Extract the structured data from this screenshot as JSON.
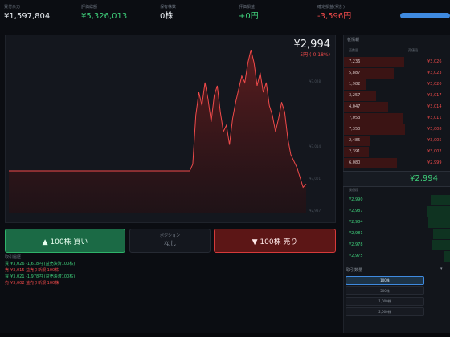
{
  "stats": [
    {
      "label": "買付余力",
      "value": "¥1,597,804",
      "tone": "white"
    },
    {
      "label": "評価総額",
      "value": "¥5,326,013",
      "tone": "green"
    },
    {
      "label": "保有株数",
      "value": "0株",
      "tone": "white"
    },
    {
      "label": "評価損益",
      "value": "+0円",
      "tone": "green"
    },
    {
      "label": "確定損益(累計)",
      "value": "-3,596円",
      "tone": "red"
    }
  ],
  "chart": {
    "price": "¥2,994",
    "change": "-5円 (-0.18%)",
    "axis_labels": [
      "¥3,028",
      "¥3,014",
      "¥3,001",
      "¥2,987"
    ],
    "line_color": "#f04a4a"
  },
  "chart_data": {
    "type": "line",
    "title": "",
    "xlabel": "",
    "ylabel": "",
    "ylim": [
      2985,
      3036
    ],
    "series": [
      {
        "name": "",
        "values": [
          2998,
          2998,
          2998,
          2998,
          2998,
          2998,
          2998,
          2998,
          2998,
          2998,
          2998,
          2998,
          2998,
          2998,
          2998,
          2998,
          2998,
          2998,
          2998,
          2998,
          2998,
          2998,
          2998,
          2998,
          2998,
          2998,
          2998,
          2998,
          2998,
          2998,
          2998,
          2998,
          2998,
          2998,
          2998,
          2998,
          2998,
          2998,
          2998,
          2998,
          2998,
          2998,
          2998,
          2998,
          2998,
          2998,
          2998,
          2998,
          2998,
          2998,
          2998,
          2998,
          2998,
          2998,
          2998,
          2998,
          2998,
          2998,
          2998,
          2998,
          3000,
          3015,
          3022,
          3018,
          3025,
          3020,
          3013,
          3021,
          3024,
          3016,
          3010,
          3012,
          3006,
          3014,
          3019,
          3023,
          3027,
          3025,
          3031,
          3035,
          3031,
          3024,
          3028,
          3022,
          3025,
          3018,
          3015,
          3010,
          3014,
          3019,
          3016,
          3008,
          3003,
          3001,
          2999,
          2996,
          2993,
          2994
        ]
      }
    ]
  },
  "buttons": {
    "buy": "▲ 100株 買い",
    "position_label": "ポジション",
    "position_value": "なし",
    "sell": "▼ 100株 売り"
  },
  "history": {
    "title": "取引履歴",
    "rows": [
      {
        "tag": "買",
        "text": "¥3,026 -1,618円 (益売決済100株)",
        "tone": "green"
      },
      {
        "tag": "売",
        "text": "¥3,015 益売り新規 100株",
        "tone": "red"
      },
      {
        "tag": "買",
        "text": "¥3,021 -1,978円 (益売決済100株)",
        "tone": "green"
      },
      {
        "tag": "売",
        "text": "¥3,002 益売り新規 100株",
        "tone": "red"
      }
    ]
  },
  "book": {
    "title": "板情報",
    "ask_header_vol": "売数量",
    "ask_header_price": "売値段",
    "asks": [
      {
        "vol": "7,236",
        "price": "¥3,026",
        "depth": 0.75
      },
      {
        "vol": "5,887",
        "price": "¥3,023",
        "depth": 0.62
      },
      {
        "vol": "1,982",
        "price": "¥3,020",
        "depth": 0.28
      },
      {
        "vol": "3,257",
        "price": "¥3,017",
        "depth": 0.4
      },
      {
        "vol": "4,047",
        "price": "¥3,014",
        "depth": 0.55
      },
      {
        "vol": "7,053",
        "price": "¥3,011",
        "depth": 0.74
      },
      {
        "vol": "7,350",
        "price": "¥3,008",
        "depth": 0.76
      },
      {
        "vol": "2,485",
        "price": "¥3,005",
        "depth": 0.32
      },
      {
        "vol": "2,391",
        "price": "¥3,002",
        "depth": 0.31
      },
      {
        "vol": "6,080",
        "price": "¥2,999",
        "depth": 0.66
      }
    ],
    "mid_price": "¥2,994",
    "bid_header": "買値段",
    "bids": [
      {
        "price": "¥2,990",
        "depth": 0.25
      },
      {
        "price": "¥2,987",
        "depth": 0.3
      },
      {
        "price": "¥2,984",
        "depth": 0.28
      },
      {
        "price": "¥2,981",
        "depth": 0.22
      },
      {
        "price": "¥2,978",
        "depth": 0.24
      },
      {
        "price": "¥2,975",
        "depth": 0.09
      }
    ],
    "qty_label": "取引数量",
    "qty_options": [
      "100株",
      "500株",
      "1,000株",
      "2,000株"
    ],
    "qty_selected": "100株"
  },
  "colors": {
    "green": "#3fd07b",
    "red": "#f04a4a",
    "accent": "#3f8ae0"
  }
}
